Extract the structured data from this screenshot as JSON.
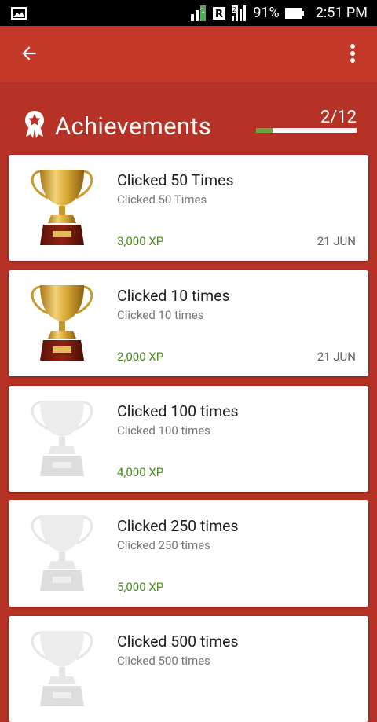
{
  "status_bar": {
    "battery": "91%",
    "time": "2:51 PM",
    "icons": [
      "image-icon",
      "data-saver-icon",
      "roaming-signal-icon",
      "signal-icon",
      "battery-icon"
    ]
  },
  "app_bar": {
    "back_icon": "arrow-back-icon",
    "menu_icon": "more-vert-icon"
  },
  "header": {
    "title": "Achievements",
    "icon": "award-ribbon-icon",
    "progress_text": "2/12",
    "progress_fraction": 0.1667,
    "colors": {
      "progress_fill": "#6ba540",
      "background": "#b73226"
    }
  },
  "achievements": [
    {
      "name": "Clicked 50 Times",
      "description": "Clicked 50 Times",
      "xp": "3,000 XP",
      "date": "21 JUN",
      "unlocked": true
    },
    {
      "name": "Clicked 10 times",
      "description": "Clicked 10 times",
      "xp": "2,000 XP",
      "date": "21 JUN",
      "unlocked": true
    },
    {
      "name": "Clicked 100 times",
      "description": "Clicked 100 times",
      "xp": "4,000 XP",
      "date": "",
      "unlocked": false
    },
    {
      "name": "Clicked 250 times",
      "description": "Clicked 250 times",
      "xp": "5,000 XP",
      "date": "",
      "unlocked": false
    },
    {
      "name": "Clicked 500 times",
      "description": "Clicked 500 times",
      "xp": "",
      "date": "",
      "unlocked": false
    }
  ]
}
